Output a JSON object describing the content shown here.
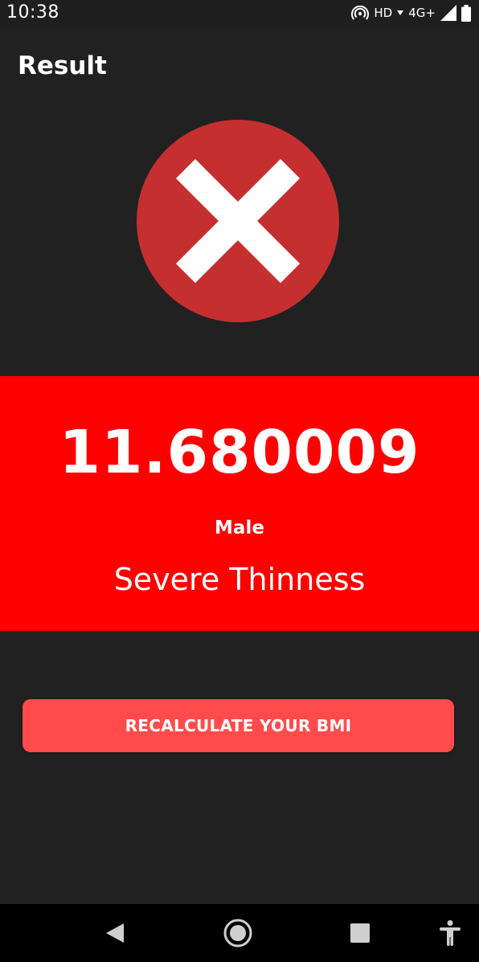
{
  "status_bar": {
    "time": "10:38",
    "network_label": "HD",
    "signal_label": "4G+",
    "icons": [
      "hotspot-icon",
      "wifi-arrow-icon",
      "signal-icon",
      "battery-icon"
    ]
  },
  "app_bar": {
    "title": "Result"
  },
  "result": {
    "icon": "error-x-icon",
    "icon_color": "#c62f2f",
    "bmi_value": "11.680009",
    "gender": "Male",
    "category": "Severe Thinness",
    "panel_color": "#ff0000"
  },
  "actions": {
    "recalculate_label": "RECALCULATE YOUR BMI",
    "button_color": "#ff4b4b"
  },
  "nav_bar": {
    "items": [
      "back-icon",
      "home-icon",
      "recents-icon",
      "accessibility-icon"
    ]
  }
}
